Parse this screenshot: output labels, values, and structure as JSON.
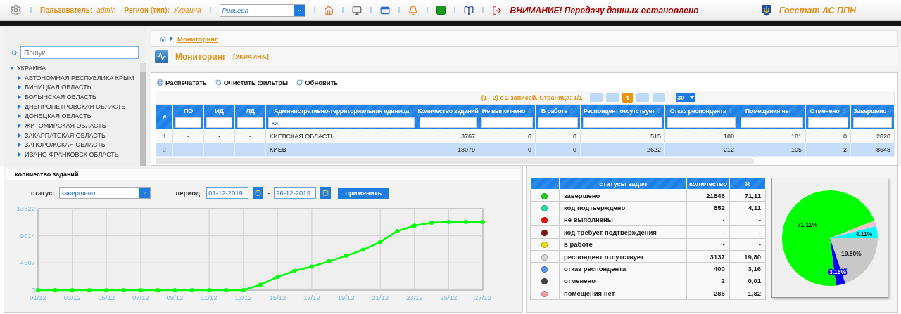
{
  "top_bar": {
    "user_label": "Пользователь:",
    "user": "admin",
    "region_label": "Регион (тип):",
    "region": "Украина",
    "select_value": "Ривьера",
    "warning": "ВНИМАНИЕ! Передачу данных остановлено",
    "brand": "Госстат АС ППН"
  },
  "sidebar": {
    "search_placeholder": "Пошук",
    "tree": [
      {
        "label": "УКРАИНА",
        "expanded": true,
        "children": [
          {
            "label": "АВТОНОМНАЯ РЕСПУБЛИКА КРЫМ",
            "expanded": false
          },
          {
            "label": "ВИНИЦКАЯ ОБЛАСТЬ",
            "expanded": false
          },
          {
            "label": "ВОЛЫНСКАЯ ОБЛАСТЬ",
            "expanded": false
          },
          {
            "label": "ДНЕПРОПЕТРОВСКАЯ ОБЛАСТЬ",
            "expanded": false
          },
          {
            "label": "ДОНЕЦКАЯ ОБЛАСТЬ",
            "expanded": false
          },
          {
            "label": "ЖИТОМИРСКАЯ ОБЛАСТЬ",
            "expanded": false
          },
          {
            "label": "ЗАКАРПАТСКАЯ ОБЛАСТЬ",
            "expanded": false
          },
          {
            "label": "ЗАПОРОЖСКАЯ ОБЛАСТЬ",
            "expanded": false
          },
          {
            "label": "ИВАНО-ФРАНКОВСК ОБЛАСТЬ",
            "expanded": false
          }
        ]
      }
    ]
  },
  "breadcrumb": {
    "items": [
      "Мониторинг"
    ]
  },
  "page_title": {
    "title": "Мониторинг",
    "region": "[УКРАИНА]"
  },
  "toolbar": [
    {
      "kind": "print",
      "label": "Распечатать"
    },
    {
      "kind": "clear",
      "label": "Очистить фильтры"
    },
    {
      "kind": "refresh",
      "label": "Обновить"
    }
  ],
  "pager": {
    "summary": "(1 - 2) с 2 записей. Страница: 1/1",
    "pages": [
      {
        "label": "1",
        "selected": true
      }
    ],
    "page_size": "30"
  },
  "table": {
    "columns": [
      {
        "label": "#",
        "filter": false,
        "sortable": false
      },
      {
        "label": "ПО",
        "filter": true,
        "sortable": false
      },
      {
        "label": "ИД",
        "filter": true,
        "sortable": false
      },
      {
        "label": "ЛД",
        "filter": true,
        "sortable": false
      },
      {
        "label": "Административно-территориальная единица",
        "filter": true,
        "sortable": false,
        "filter_value": "ки"
      },
      {
        "label": "Количество заданий",
        "filter": true,
        "sortable": false
      },
      {
        "label": "Не выполнено",
        "filter": true,
        "sortable": true
      },
      {
        "label": "В работе",
        "filter": true,
        "sortable": true
      },
      {
        "label": "Респондент отсутствует",
        "filter": true,
        "sortable": true
      },
      {
        "label": "Отказ респондента",
        "filter": true,
        "sortable": true
      },
      {
        "label": "Помещения нет",
        "filter": true,
        "sortable": true
      },
      {
        "label": "Отменено",
        "filter": true,
        "sortable": true
      },
      {
        "label": "Завершено",
        "filter": true,
        "sortable": true
      }
    ],
    "rows": [
      {
        "selected": false,
        "cells": [
          "1",
          "-",
          "-",
          "-",
          "КИЕВСКАЯ ОБЛАСТЬ",
          "3767",
          "0",
          "0",
          "515",
          "188",
          "181",
          "0",
          "2620"
        ]
      },
      {
        "selected": true,
        "cells": [
          "2",
          "-",
          "-",
          "-",
          "КИЕВ",
          "18079",
          "0",
          "0",
          "2622",
          "212",
          "105",
          "2",
          "8648"
        ]
      }
    ]
  },
  "chart_panel": {
    "title": "количество заданий",
    "status_label": "статус:",
    "status_value": "завершено",
    "period_label": "период:",
    "date_from": "01-12-2019",
    "separator": "-",
    "date_to": "26-12-2019",
    "apply": "применить",
    "chart_data": {
      "type": "line",
      "categories": [
        "01/12",
        null,
        "03/12",
        null,
        "05/12",
        null,
        "07/12",
        null,
        "09/12",
        null,
        "11/12",
        null,
        "13/12",
        null,
        "15/12",
        null,
        "17/12",
        null,
        "19/12",
        null,
        "21/12",
        null,
        "23/12",
        null,
        "25/12",
        null,
        "27/12"
      ],
      "series": [
        {
          "color": "#00ff00",
          "marker": true,
          "values": [
            0,
            0,
            0,
            0,
            0,
            0,
            0,
            0,
            0,
            0,
            0,
            0,
            0,
            900,
            2200,
            3200,
            3900,
            4800,
            5700,
            6700,
            8000,
            9800,
            10700,
            11200,
            11300,
            11300,
            11300
          ]
        }
      ],
      "ylim": [
        0,
        13522
      ],
      "yticks": [
        0,
        4507,
        9014,
        13522
      ],
      "grid": true
    }
  },
  "status_table": {
    "columns": [
      "статусы задач",
      "количество",
      "%"
    ],
    "rows": [
      {
        "status": "завершено",
        "color": "#22cc22",
        "count": "21846",
        "percent": "71,11"
      },
      {
        "status": "код подтверждено",
        "color": "#22ddaa",
        "count": "852",
        "percent": "4,11"
      },
      {
        "status": "не выполнены",
        "color": "#ee1111",
        "count": "-",
        "percent": "-"
      },
      {
        "status": "код требует подтверждения",
        "color": "#881111",
        "count": "-",
        "percent": "-"
      },
      {
        "status": "в работе",
        "color": "#eedd11",
        "count": "-",
        "percent": "-"
      },
      {
        "status": "респондент отсутствует",
        "color": "#d8d8d8",
        "count": "3137",
        "percent": "19,80"
      },
      {
        "status": "отказ респондента",
        "color": "#5599ee",
        "count": "400",
        "percent": "3,16"
      },
      {
        "status": "отменено",
        "color": "#444444",
        "count": "2",
        "percent": "0,01"
      },
      {
        "status": "помещения нет",
        "color": "#f4a0a0",
        "count": "286",
        "percent": "1,82"
      }
    ]
  },
  "pie": {
    "chart_data": {
      "type": "pie",
      "values": [
        19.8,
        3.16,
        71.11,
        1.82,
        4.11
      ],
      "colors": [
        "#c8c8c8",
        "#0000ff",
        "#00ff00",
        "#ffc0cb",
        "#00ffff"
      ],
      "value_labels": [
        "19.80%",
        "3.16%",
        "71.11%",
        null,
        "4.11%"
      ]
    }
  }
}
